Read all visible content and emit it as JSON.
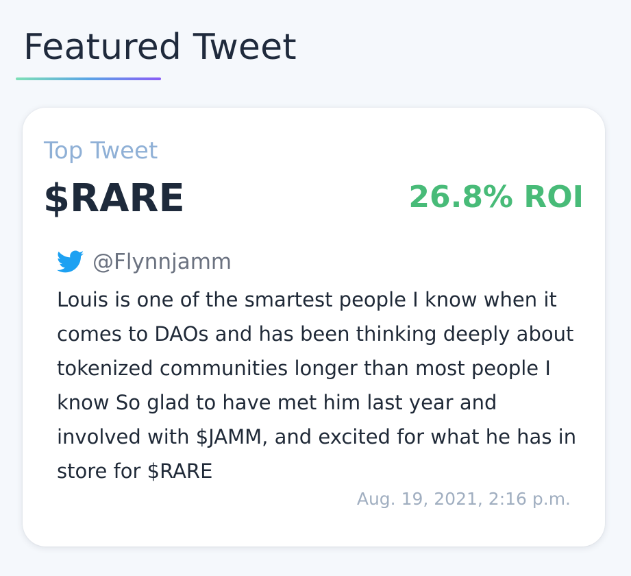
{
  "section": {
    "title": "Featured Tweet",
    "underline_gradient": [
      "#7ee0b6",
      "#5aa5e6",
      "#8a5cf6"
    ]
  },
  "card": {
    "label": "Top Tweet",
    "ticker": "$RARE",
    "roi": "26.8% ROI",
    "roi_color": "#48bb78"
  },
  "tweet": {
    "icon": "twitter-icon",
    "icon_color": "#1da1f2",
    "handle": "@Flynnjamm",
    "text": "Louis is one of the smartest people I know when it comes to DAOs and has been thinking deeply about tokenized communities longer than most people I know So glad to have met him last year and involved with $JAMM, and excited for what he has in store for $RARE",
    "timestamp": "Aug. 19, 2021, 2:16 p.m."
  }
}
